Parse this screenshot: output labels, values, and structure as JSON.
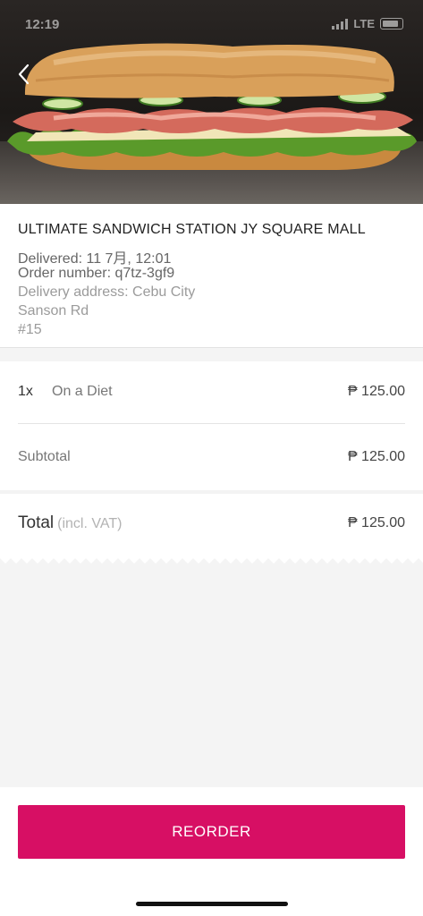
{
  "status_bar": {
    "time": "12:19",
    "carrier": "LTE"
  },
  "header": {
    "back_icon": "chevron-left-icon"
  },
  "order_info": {
    "store_name": "ULTIMATE SANDWICH STATION JY SQUARE MALL",
    "delivered": "Delivered: 11 7月, 12:01",
    "order_number": "Order number: q7tz-3gf9",
    "address_line1": "Delivery address: Cebu City",
    "address_line2": "Sanson Rd",
    "address_line3": "#15"
  },
  "items": [
    {
      "qty": "1x",
      "name": "On a Diet",
      "price": "₱ 125.00"
    }
  ],
  "summary": {
    "subtotal_label": "Subtotal",
    "subtotal_value": "₱ 125.00",
    "total_label": "Total",
    "total_note": "(incl. VAT)",
    "total_value": "₱ 125.00"
  },
  "actions": {
    "reorder_label": "REORDER"
  },
  "colors": {
    "accent": "#d70f64"
  }
}
